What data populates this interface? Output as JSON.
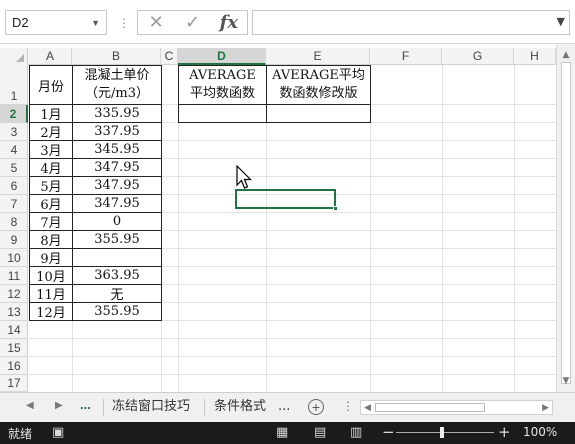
{
  "formula_bar": {
    "name_box": "D2",
    "formula": ""
  },
  "columns": [
    "A",
    "B",
    "C",
    "D",
    "E",
    "F",
    "G",
    "H"
  ],
  "selected_column": "D",
  "rows": [
    "1",
    "2",
    "3",
    "4",
    "5",
    "6",
    "7",
    "8",
    "9",
    "10",
    "11",
    "12",
    "13",
    "14",
    "15",
    "16",
    "17"
  ],
  "selected_row": "2",
  "table": {
    "header_month": "月份",
    "header_price": "混凝土单价\n（元/m3）",
    "months": [
      "1月",
      "2月",
      "3月",
      "4月",
      "5月",
      "6月",
      "7月",
      "8月",
      "9月",
      "10月",
      "11月",
      "12月"
    ],
    "prices": [
      "335.95",
      "337.95",
      "345.95",
      "347.95",
      "347.95",
      "347.95",
      "0",
      "355.95",
      "",
      "363.95",
      "无",
      "355.95"
    ]
  },
  "func_table": {
    "d_header": "AVERAGE\n平均数函数",
    "e_header": "AVERAGE平均\n数函数修改版"
  },
  "sheet_tabs": {
    "ellipsis_left": "...",
    "tab1": "冻结窗口技巧",
    "tab2": "条件格式",
    "ellipsis_right": "..."
  },
  "status_bar": {
    "status": "就绪",
    "zoom": "100%"
  },
  "colors": {
    "accent": "#217346",
    "statusbar_bg": "#1b1b1b"
  }
}
